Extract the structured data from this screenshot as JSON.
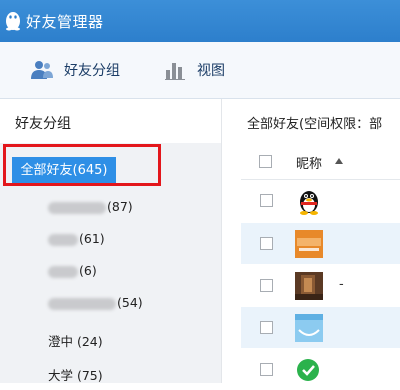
{
  "window": {
    "title": "好友管理器"
  },
  "toolbar": {
    "groups_label": "好友分组",
    "view_label": "视图"
  },
  "left": {
    "header": "好友分组",
    "selected_group": "全部好友(645)",
    "groups": [
      {
        "visible_text": "(87)"
      },
      {
        "visible_text": "(61)"
      },
      {
        "visible_text": "(6)"
      },
      {
        "visible_text": "(54)"
      },
      {
        "visible_text": "澄中 (24)"
      },
      {
        "visible_text": "大学 (75)"
      }
    ]
  },
  "right": {
    "header": "全部好友(空间权限：部",
    "column_nickname": "昵称",
    "rows": [
      {
        "avatar": "qq-penguin-avatar",
        "nick": ""
      },
      {
        "avatar": "orange-logo-avatar",
        "nick": ""
      },
      {
        "avatar": "photo-avatar",
        "nick": "-"
      },
      {
        "avatar": "blue-sky-avatar",
        "nick": ""
      },
      {
        "avatar": "green-chat-avatar",
        "nick": ""
      }
    ]
  },
  "colors": {
    "titlebar": "#2d7fcc",
    "selected": "#2e8fe6",
    "highlight": "#e3161b",
    "row_alt": "#eaf3fb"
  }
}
